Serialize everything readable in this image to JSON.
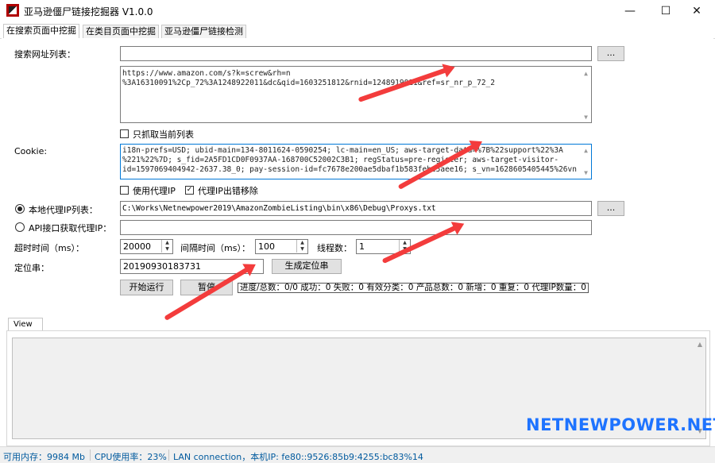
{
  "window": {
    "title": "亚马逊僵尸链接挖掘器 V1.0.0",
    "buttons": {
      "minimize": "—",
      "maximize": "☐",
      "close": "✕"
    }
  },
  "tabs": [
    {
      "label": "在搜索页面中挖掘",
      "active": true
    },
    {
      "label": "在类目页面中挖掘",
      "active": false
    },
    {
      "label": "亚马逊僵尸链接检测",
      "active": false
    }
  ],
  "search": {
    "label": "搜索网址列表：",
    "path_value": "",
    "browse_label": "...",
    "urls": [
      "https://www.amazon.com/s?k=screw&rh=n",
      "%3A16310091%2Cp_72%3A1248922011&dc&qid=1603251812&rnid=1248919011&ref=sr_nr_p_72_2"
    ],
    "only_current_label": "只抓取当前列表",
    "only_current_checked": false
  },
  "cookie": {
    "label": "Cookie:",
    "lines": [
      "i18n-prefs=USD; ubid-main=134-8011624-0590254; lc-main=en_US; aws-target-data=%7B%22support%22%3A",
      "%221%22%7D; s_fid=2A5FD1CD0F0937AA-168700C52002C3B1; regStatus=pre-register; aws-target-visitor-",
      "id=1597069404942-2637.38_0; pay-session-id=fc7678e200ae5dbaf1b583febe5aee16; s_vn=1628605405445%26vn"
    ]
  },
  "proxy": {
    "use_proxy_label": "使用代理IP",
    "use_proxy_checked": false,
    "remove_bad_label": "代理IP出错移除",
    "remove_bad_checked": true,
    "local_list_label": "本地代理IP列表：",
    "local_list_selected": true,
    "local_list_value": "C:\\Works\\Netnewpower2019\\AmazonZombieListing\\bin\\x86\\Debug\\Proxys.txt",
    "browse_label": "...",
    "api_label": "API接口获取代理IP：",
    "api_selected": false,
    "api_value": ""
  },
  "settings": {
    "timeout_label": "超时时间（ms）：",
    "timeout_value": "20000",
    "interval_label": "间隔时间（ms）：",
    "interval_value": "100",
    "threads_label": "线程数：",
    "threads_value": "1",
    "locator_label": "定位串：",
    "locator_value": "20190930183731",
    "generate_label": "生成定位串"
  },
  "actions": {
    "start_label": "开始运行",
    "pause_label": "暂停",
    "progress_text": "进度/总数：0/0 成功：0 失败：0 有效分类：0 产品总数：0 新增：0 重复：0 代理IP数量：0"
  },
  "view": {
    "tab_label": "View"
  },
  "watermark": "NETNEWPOWER.NET",
  "status": {
    "memory": "可用内存：9984 Mb",
    "cpu": "CPU使用率：23%",
    "network": "LAN connection，本机IP: fe80::9526:85b9:4255:bc83%14"
  },
  "colors": {
    "annotation_arrow": "#f33c3c",
    "watermark": "#1e73ff",
    "status_text": "#005a9e"
  }
}
